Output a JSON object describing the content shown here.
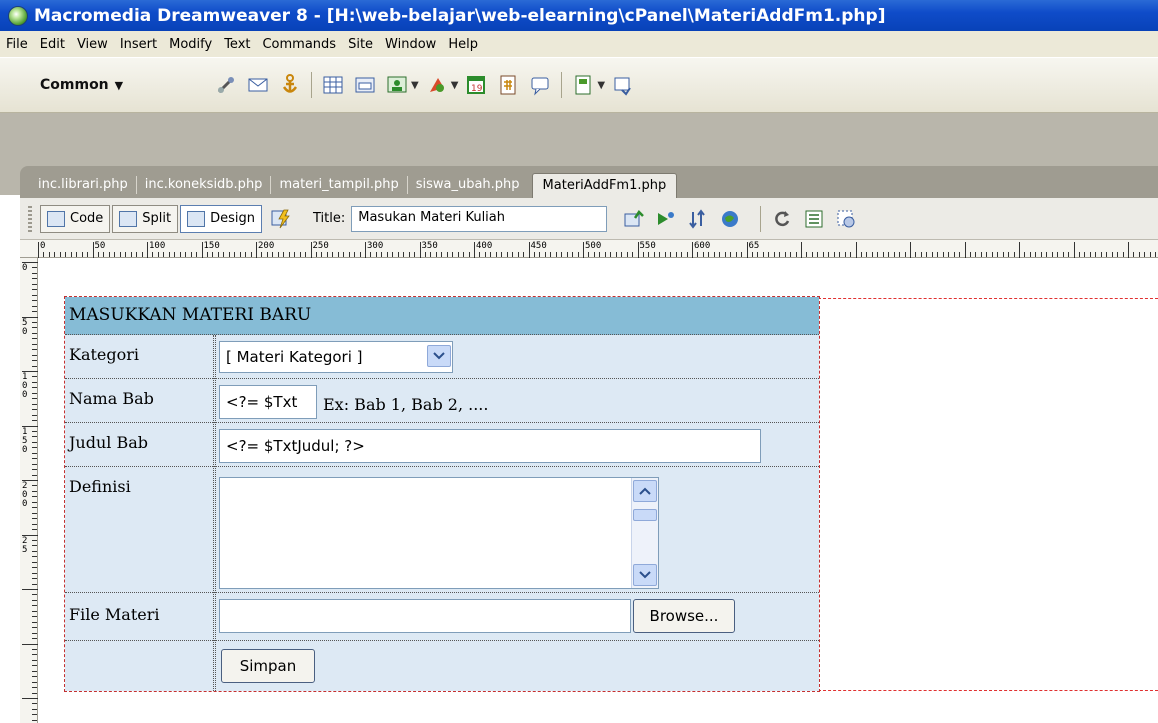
{
  "window": {
    "title": "Macromedia Dreamweaver 8 - [H:\\web-belajar\\web-elearning\\cPanel\\MateriAddFm1.php]"
  },
  "menu": [
    "File",
    "Edit",
    "View",
    "Insert",
    "Modify",
    "Text",
    "Commands",
    "Site",
    "Window",
    "Help"
  ],
  "insert_toolbar": {
    "category": "Common",
    "icons": [
      "hyperlink-icon",
      "email-link-icon",
      "named-anchor-icon",
      "table-icon",
      "div-icon",
      "images-icon",
      "media-icon",
      "date-icon",
      "server-side-include-icon",
      "comment-icon",
      "templates-icon",
      "tag-chooser-icon"
    ]
  },
  "tabs": [
    "inc.librari.php",
    "inc.koneksidb.php",
    "materi_tampil.php",
    "siswa_ubah.php",
    "MateriAddFm1.php"
  ],
  "active_tab": "MateriAddFm1.php",
  "document_toolbar": {
    "code_label": "Code",
    "split_label": "Split",
    "design_label": "Design",
    "title_label": "Title:",
    "title_value": "Masukan Materi Kuliah"
  },
  "ruler": {
    "h_labels": [
      "0",
      "50",
      "100",
      "150",
      "200",
      "250",
      "300",
      "350",
      "400",
      "450",
      "500",
      "550",
      "600",
      "65"
    ],
    "v_labels": [
      "0",
      "50",
      "100",
      "150",
      "200",
      "25"
    ]
  },
  "form": {
    "heading": "MASUKKAN MATERI BARU",
    "kategori_label": "Kategori",
    "kategori_value": "[ Materi Kategori ]",
    "nama_bab_label": "Nama Bab",
    "nama_bab_value": "<?= $Txt",
    "nama_bab_hint": "Ex: Bab 1, Bab 2, ....",
    "judul_bab_label": "Judul Bab",
    "judul_bab_value": "<?= $TxtJudul; ?>",
    "definisi_label": "Definisi",
    "file_materi_label": "File Materi",
    "browse_label": "Browse...",
    "simpan_label": "Simpan"
  },
  "colors": {
    "titlebar": "#0842b8",
    "form_header": "#86bcd6",
    "form_row": "#dde9f4",
    "table_border": "#c43030"
  }
}
